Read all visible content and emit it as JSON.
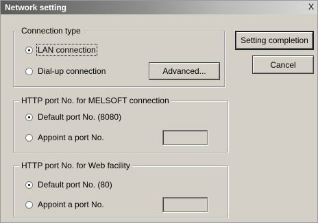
{
  "window": {
    "title": "Network setting",
    "close_symbol": "X"
  },
  "connection_type": {
    "legend": "Connection type",
    "options": [
      {
        "label": "LAN connection",
        "selected": true
      },
      {
        "label": "Dial-up connection",
        "selected": false
      }
    ],
    "advanced_label": "Advanced..."
  },
  "melsoft_port": {
    "legend": "HTTP port No. for MELSOFT connection",
    "options": [
      {
        "label": "Default port No. (8080)",
        "selected": true
      },
      {
        "label": "Appoint a port No.",
        "selected": false
      }
    ],
    "port_value": ""
  },
  "web_port": {
    "legend": "HTTP port No. for Web facility",
    "options": [
      {
        "label": "Default port No. (80)",
        "selected": true
      },
      {
        "label": "Appoint a port No.",
        "selected": false
      }
    ],
    "port_value": ""
  },
  "buttons": {
    "setting_completion": "Setting completion",
    "cancel": "Cancel"
  }
}
